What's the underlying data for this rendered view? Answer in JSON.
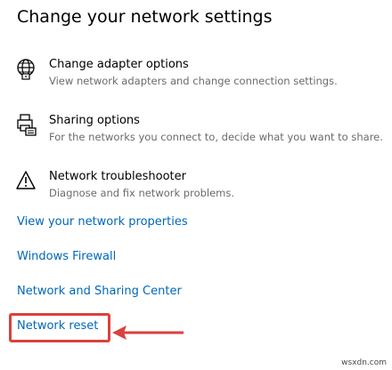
{
  "page": {
    "title": "Change your network settings"
  },
  "options": [
    {
      "icon": "globe-network-icon",
      "title": "Change adapter options",
      "description": "View network adapters and change connection settings."
    },
    {
      "icon": "printer-sharing-icon",
      "title": "Sharing options",
      "description": "For the networks you connect to, decide what you want to share."
    },
    {
      "icon": "warning-triangle-icon",
      "title": "Network troubleshooter",
      "description": "Diagnose and fix network problems."
    }
  ],
  "links": {
    "view_properties": "View your network properties",
    "windows_firewall": "Windows Firewall",
    "sharing_center": "Network and Sharing Center",
    "network_reset": "Network reset"
  },
  "annotation": {
    "color": "#d9423d"
  },
  "colors": {
    "link": "#0067b8",
    "description": "#6b6b6b"
  },
  "watermark": "wsxdn.com"
}
